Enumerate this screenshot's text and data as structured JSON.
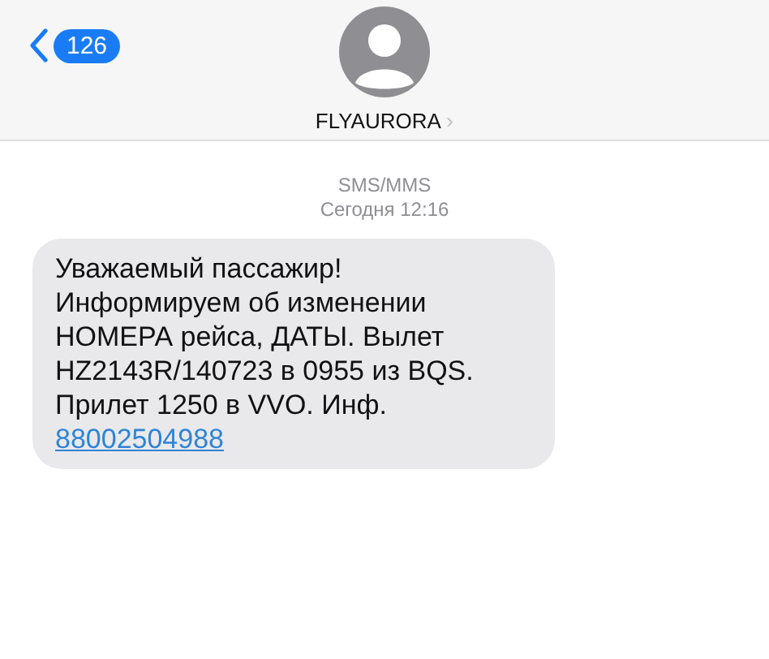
{
  "header": {
    "back_count": "126",
    "contact": "FLYAURORA",
    "chevron": "›"
  },
  "thread": {
    "service": "SMS/MMS",
    "timestamp": "Сегодня 12:16"
  },
  "messages": [
    {
      "kind": "incoming",
      "lines": [
        "Уважаемый пассажир!",
        "Информируем об изменении",
        "НОМЕРА рейса, ДАТЫ. Вылет",
        "HZ2143R/140723 в 0955 из BQS.",
        "Прилет 1250 в VVO. Инф."
      ],
      "link": "88002504988"
    }
  ]
}
